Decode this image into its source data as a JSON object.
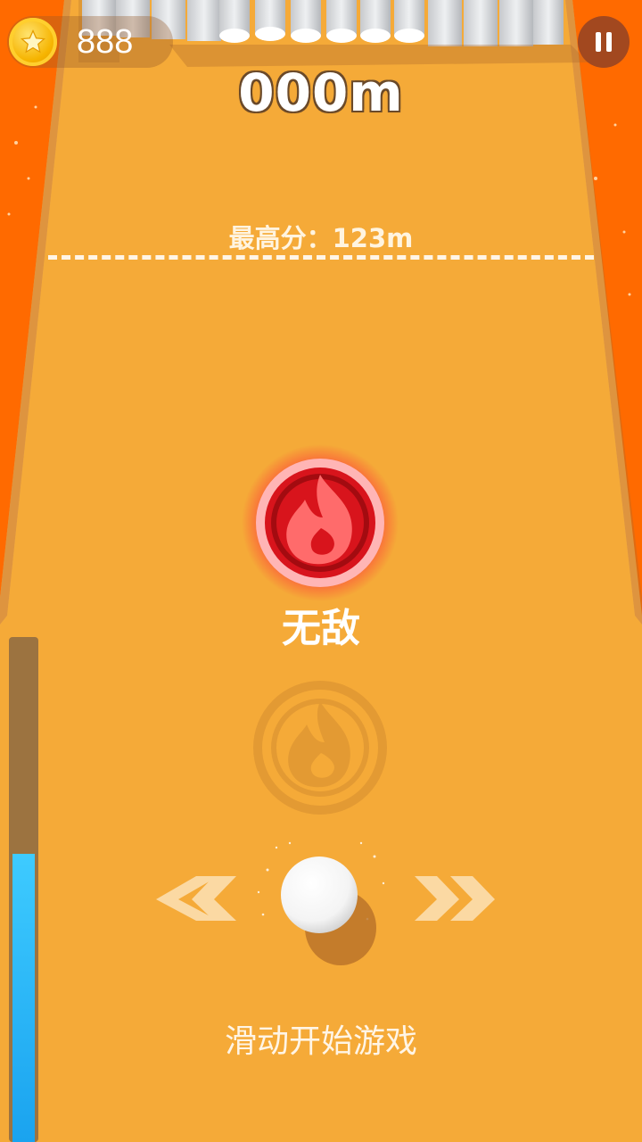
{
  "hud": {
    "coins": "888",
    "distance": "000m"
  },
  "track": {
    "best_score": "最高分：123m"
  },
  "powerup": {
    "label": "无敌",
    "icon": "fire-icon"
  },
  "controls": {
    "left_icon": "double-chevron-left-icon",
    "right_icon": "double-chevron-right-icon",
    "start_hint": "滑动开始游戏"
  },
  "progress": {
    "fill_fraction": 0.57
  },
  "colors": {
    "lava": "#ff6a00",
    "track": "#f5aa38",
    "powerup_red": "#d8141c",
    "progress_blue": "#23b4f6"
  }
}
